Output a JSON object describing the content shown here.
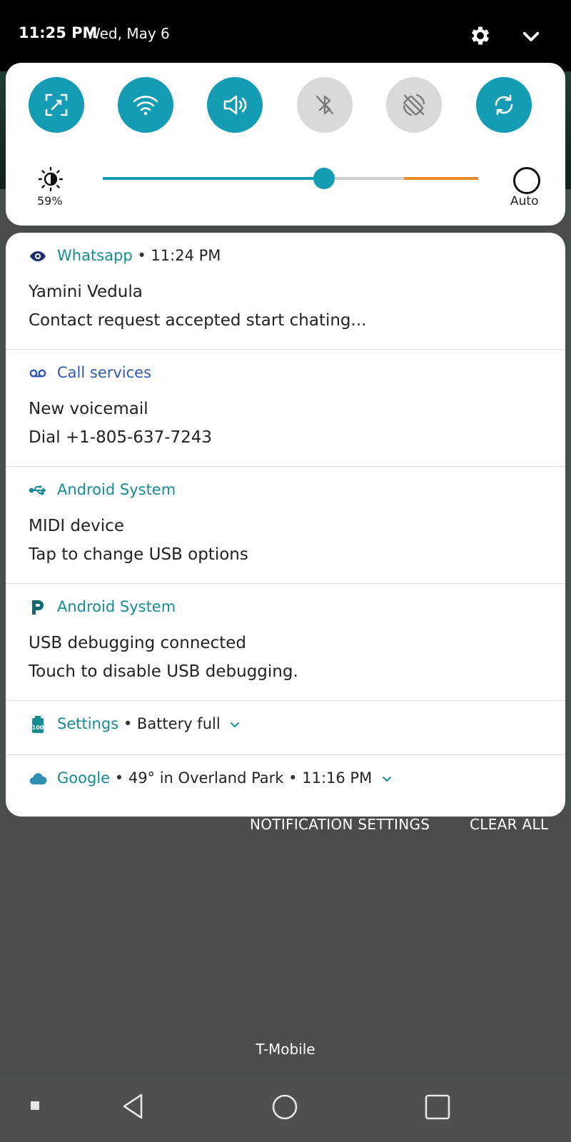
{
  "status_bar": {
    "time": "11:25 PM",
    "date": "Wed, May 6"
  },
  "quick_settings": {
    "tiles": [
      {
        "name": "screenshot",
        "state": "on"
      },
      {
        "name": "wifi",
        "state": "on"
      },
      {
        "name": "sound",
        "state": "on"
      },
      {
        "name": "bluetooth",
        "state": "off"
      },
      {
        "name": "auto-rotate",
        "state": "off"
      },
      {
        "name": "sync",
        "state": "on"
      }
    ],
    "brightness": {
      "percent_label": "59%",
      "level": 0.59,
      "auto_label": "Auto"
    },
    "colors": {
      "accent": "#139cb3",
      "off": "#d9d9d9",
      "warning": "#e88a2e"
    }
  },
  "notifications": [
    {
      "app": "Whatsapp",
      "sep": "•",
      "time": "11:24 PM",
      "title": "Yamini Vedula",
      "text": "Contact request accepted start chating...",
      "icon": "eye-icon"
    },
    {
      "app": "Call services",
      "title": "New voicemail",
      "text": "Dial +1-805-637-7243",
      "icon": "voicemail-icon"
    },
    {
      "app": "Android System",
      "title": "MIDI device",
      "text": "Tap to change USB options",
      "icon": "usb-icon"
    },
    {
      "app": "Android System",
      "title": "USB debugging connected",
      "text": "Touch to disable USB debugging.",
      "icon": "p-icon"
    },
    {
      "app": "Settings",
      "sep": "•",
      "summary": "Battery full",
      "icon": "battery-full-icon"
    },
    {
      "app": "Google",
      "sep": "•",
      "summary": "49° in Overland Park",
      "sep2": "•",
      "time": "11:16 PM",
      "icon": "cloud-icon"
    }
  ],
  "actions": {
    "notification_settings": "NOTIFICATION SETTINGS",
    "clear_all": "CLEAR ALL"
  },
  "carrier": "T-Mobile"
}
